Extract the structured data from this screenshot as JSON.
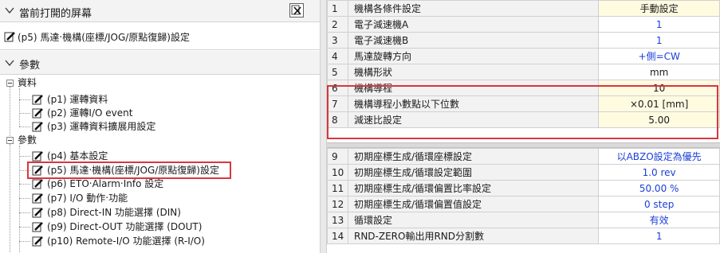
{
  "left": {
    "open_screens_title": "當前打開的屏幕",
    "current_screen": "(p5) 馬達‧機構(座標/JOG/原點復歸)設定",
    "params_title": "參數",
    "tree": {
      "data_group": "資料",
      "data_items": [
        "(p1) 運轉資料",
        "(p2) 運轉I/O event",
        "(p3) 運轉資料擴展用設定"
      ],
      "param_group": "參數",
      "param_items": [
        "(p4) 基本設定",
        "(p5) 馬達‧機構(座標/JOG/原點復歸)設定",
        "(p6) ETO‧Alarm‧Info 設定",
        "(p7) I/O 動作‧功能",
        "(p8) Direct-IN 功能選擇 (DIN)",
        "(p9) Direct-OUT 功能選擇 (DOUT)",
        "(p10) Remote-I/O 功能選擇 (R-I/O)"
      ]
    }
  },
  "right": {
    "upper_rows": [
      {
        "no": "1",
        "name": "機構各條件設定",
        "value": "手動設定"
      },
      {
        "no": "2",
        "name": "電子減速機A",
        "value": "1"
      },
      {
        "no": "3",
        "name": "電子減速機B",
        "value": "1"
      },
      {
        "no": "4",
        "name": "馬達旋轉方向",
        "value": "+側=CW"
      },
      {
        "no": "5",
        "name": "機構形狀",
        "value": "mm"
      },
      {
        "no": "6",
        "name": "機構導程",
        "value": "10"
      },
      {
        "no": "7",
        "name": "機構導程小數點以下位數",
        "value": "×0.01 [mm]"
      },
      {
        "no": "8",
        "name": "減速比設定",
        "value": "5.00"
      }
    ],
    "lower_rows": [
      {
        "no": "9",
        "name": "初期座標生成/循環座標設定",
        "value": "以ABZO設定為優先"
      },
      {
        "no": "10",
        "name": "初期座標生成/循環設定範圍",
        "value": "1.0 rev"
      },
      {
        "no": "11",
        "name": "初期座標生成/循環偏置比率設定",
        "value": "50.00 %"
      },
      {
        "no": "12",
        "name": "初期座標生成/循環偏置值設定",
        "value": "0 step"
      },
      {
        "no": "13",
        "name": "循環設定",
        "value": "有效"
      },
      {
        "no": "14",
        "name": "RND-ZERO輸出用RND分割數",
        "value": "1"
      }
    ]
  },
  "colors": {
    "highlight_red": "#d9363e",
    "value_blue": "#1a3fd6",
    "value_bg_yellow": "#fffbe1"
  }
}
